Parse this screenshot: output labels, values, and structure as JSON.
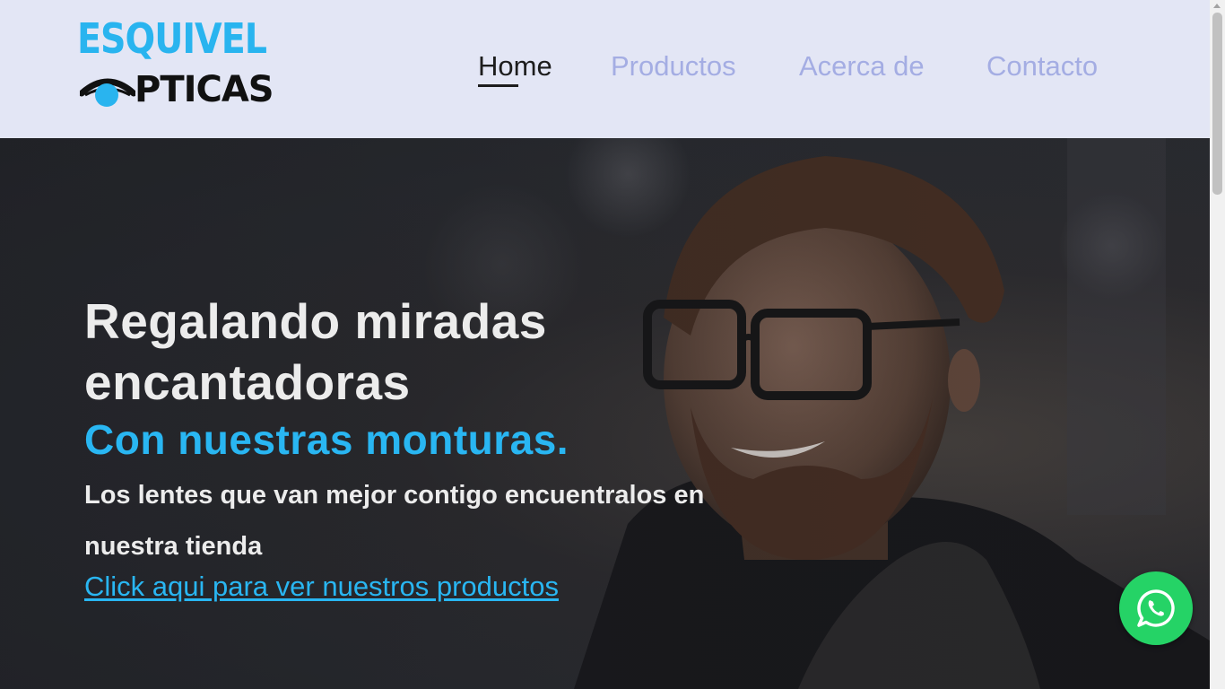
{
  "header": {
    "logo": {
      "line1": "ESQUIVEL",
      "line2": "PTICAS",
      "icon": "eye-icon"
    },
    "nav": [
      {
        "label": "Home",
        "active": true
      },
      {
        "label": "Productos",
        "active": false
      },
      {
        "label": "Acerca de",
        "active": false
      },
      {
        "label": "Contacto",
        "active": false
      }
    ]
  },
  "hero": {
    "title": "Regalando miradas encantadoras",
    "subtitle": "Con nuestras monturas.",
    "body": "Los lentes que van mejor contigo encuentralos en nuestra tienda",
    "link": "Click aqui para ver nuestros productos"
  },
  "floating": {
    "whatsapp_icon": "whatsapp-icon"
  },
  "colors": {
    "header_bg": "#e3e6f5",
    "nav_inactive": "#a4ade3",
    "nav_active": "#1d1d1d",
    "accent": "#29b6f2",
    "whatsapp": "#25d366"
  }
}
